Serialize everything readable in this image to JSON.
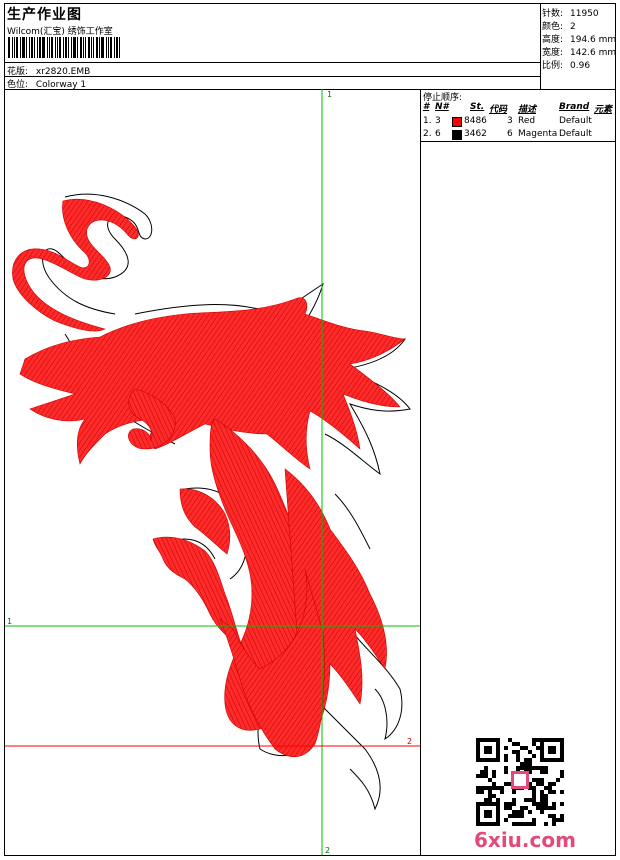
{
  "header": {
    "title": "生产作业图",
    "company": "Wilcom(汇宝) 绣饰工作室",
    "design_label": "花版:",
    "design_value": "xr2820.EMB",
    "colorway_label": "色位:",
    "colorway_value": "Colorway 1"
  },
  "stats": [
    {
      "label": "针数:",
      "value": "11950"
    },
    {
      "label": "颜色:",
      "value": "2"
    },
    {
      "label": "高度:",
      "value": "194.6 mm"
    },
    {
      "label": "宽度:",
      "value": "142.6 mm"
    },
    {
      "label": "比例:",
      "value": "0.96"
    }
  ],
  "stop_sequence": {
    "title": "停止顺序:",
    "columns": [
      "#",
      "N#",
      "St.",
      "代码",
      "描述",
      "Brand",
      "元素"
    ],
    "rows": [
      {
        "index": "1.",
        "needle": "3",
        "stitches": "8486",
        "code": "3",
        "desc": "Red",
        "brand": "Default",
        "color": "#ff0000"
      },
      {
        "index": "2.",
        "needle": "6",
        "stitches": "3462",
        "code": "6",
        "desc": "Magenta",
        "brand": "Default",
        "color": "#000000"
      }
    ]
  },
  "guides": {
    "v1": "1",
    "v2": "2",
    "h1": "1",
    "h2": "2"
  },
  "watermark": "6xiu.com",
  "colors": {
    "stitch": "#ff0000",
    "guide_green": "#00c000",
    "guide_red": "#ff0000",
    "outline": "#000000",
    "watermark": "#e24a7a"
  }
}
